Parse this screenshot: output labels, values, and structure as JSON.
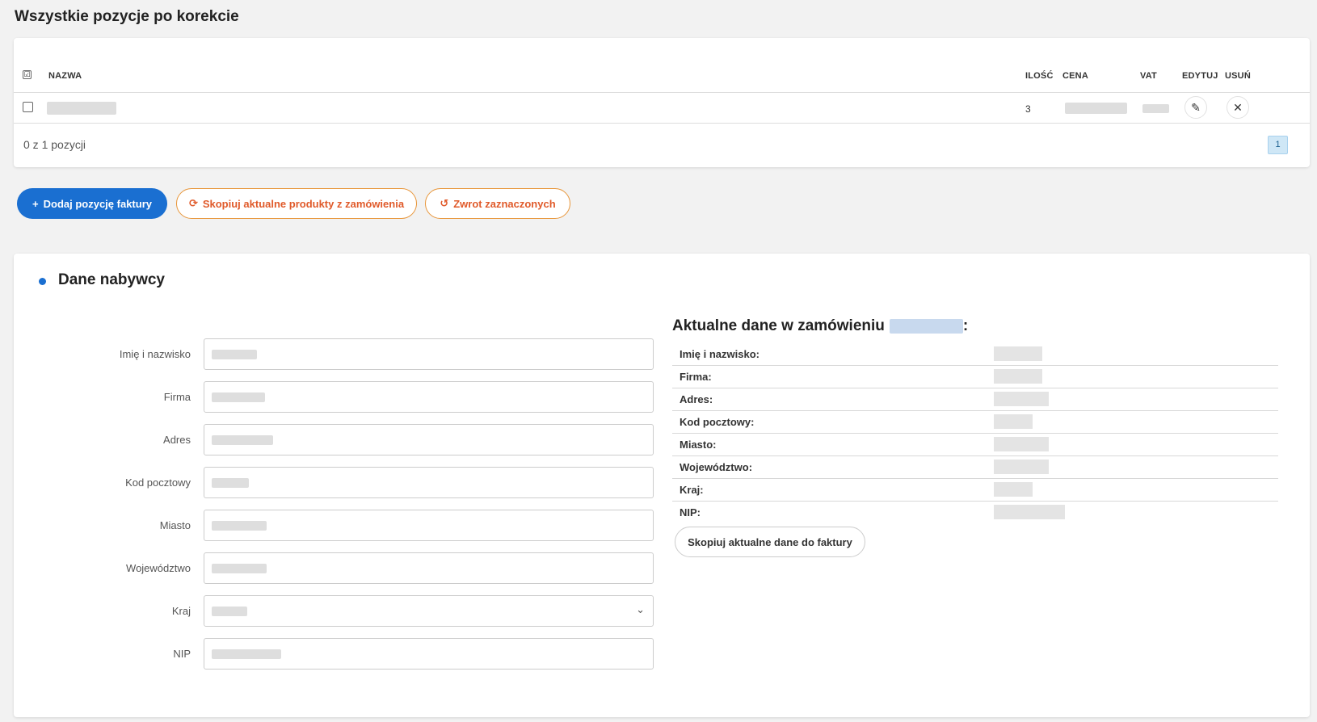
{
  "positions": {
    "title": "Wszystkie pozycje po korekcie",
    "columns": {
      "check": "☑",
      "name": "NAZWA",
      "qty": "ILOŚĆ",
      "price": "CENA",
      "vat": "VAT",
      "edit": "EDYTUJ",
      "delete": "USUŃ"
    },
    "rows": [
      {
        "qty": "3"
      }
    ],
    "pager_info": "0 z 1 pozycji",
    "page": "1"
  },
  "actions": {
    "add_label": "Dodaj pozycję faktury",
    "copy_label": "Skopiuj aktualne produkty z zamówienia",
    "return_label": "Zwrot zaznaczonych"
  },
  "buyer": {
    "title": "Dane nabywcy",
    "fields": {
      "name": "Imię i nazwisko",
      "company": "Firma",
      "address": "Adres",
      "postal": "Kod pocztowy",
      "city": "Miasto",
      "region": "Województwo",
      "country": "Kraj",
      "nip": "NIP"
    },
    "current": {
      "title": "Aktualne dane w zamówieniu",
      "title_suffix": ":",
      "labels": {
        "name": "Imię i nazwisko:",
        "company": "Firma:",
        "address": "Adres:",
        "postal": "Kod pocztowy:",
        "city": "Miasto:",
        "region": "Województwo:",
        "country": "Kraj:",
        "nip": "NIP:"
      },
      "copy_button": "Skopiuj aktualne dane do faktury"
    }
  },
  "colors": {
    "primary": "#1a6fd1",
    "accent_orange": "#e05a2a"
  }
}
